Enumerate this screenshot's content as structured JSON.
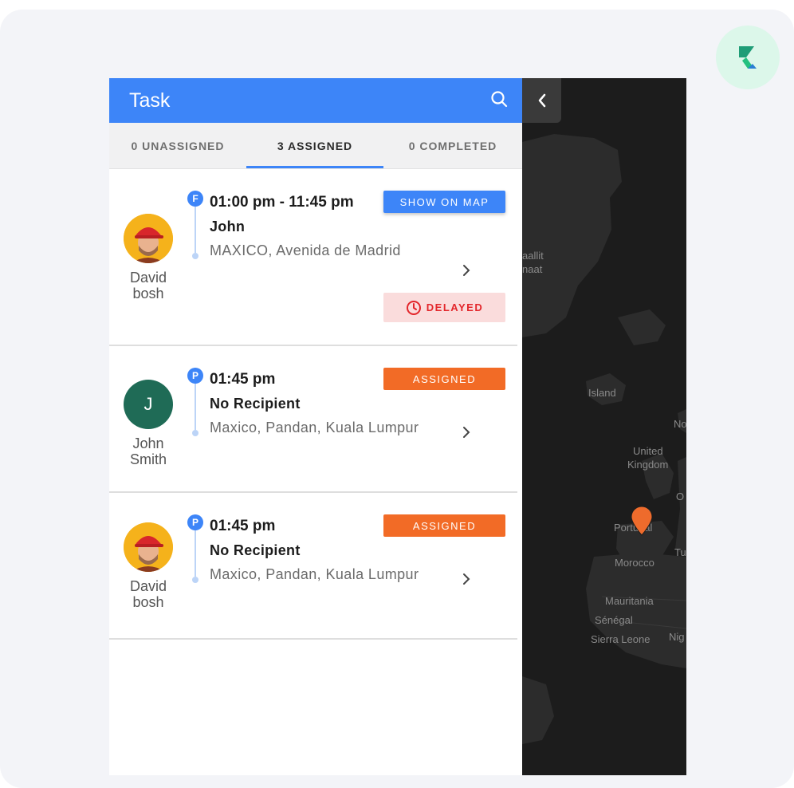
{
  "header": {
    "title": "Task"
  },
  "tabs": [
    {
      "label": "0 UNASSIGNED",
      "active": false
    },
    {
      "label": "3 ASSIGNED",
      "active": true
    },
    {
      "label": "0 COMPLETED",
      "active": false
    }
  ],
  "tasks": [
    {
      "agent": {
        "name": "David bosh",
        "avatar": "photo"
      },
      "stop_type": "F",
      "time": "01:00 pm - 11:45 pm",
      "recipient": "John",
      "address": "MAXICO, Avenida de Madrid",
      "action_label": "SHOW ON MAP",
      "delay_label": "DELAYED"
    },
    {
      "agent": {
        "name": "John Smith",
        "initial": "J",
        "avatar_color": "#1f6b56"
      },
      "stop_type": "P",
      "time": "01:45 pm",
      "recipient": "No Recipient",
      "address": "Maxico, Pandan, Kuala Lumpur",
      "status_label": "ASSIGNED"
    },
    {
      "agent": {
        "name": "David bosh",
        "avatar": "photo"
      },
      "stop_type": "P",
      "time": "01:45 pm",
      "recipient": "No Recipient",
      "address": "Maxico, Pandan, Kuala Lumpur",
      "status_label": "ASSIGNED"
    }
  ],
  "map": {
    "labels": [
      "aallit",
      "naat",
      "Island",
      "United",
      "Kingdom",
      "Portugal",
      "Morocco",
      "Mauritania",
      "Sénégal",
      "Sierra Leone",
      "No",
      "Nig",
      "O",
      "Tu"
    ]
  },
  "colors": {
    "primary": "#3d85f8",
    "assigned": "#f26b26",
    "delayed_bg": "#fadcdc",
    "delayed_text": "#e3262b",
    "map_bg": "#1c1c1c"
  }
}
